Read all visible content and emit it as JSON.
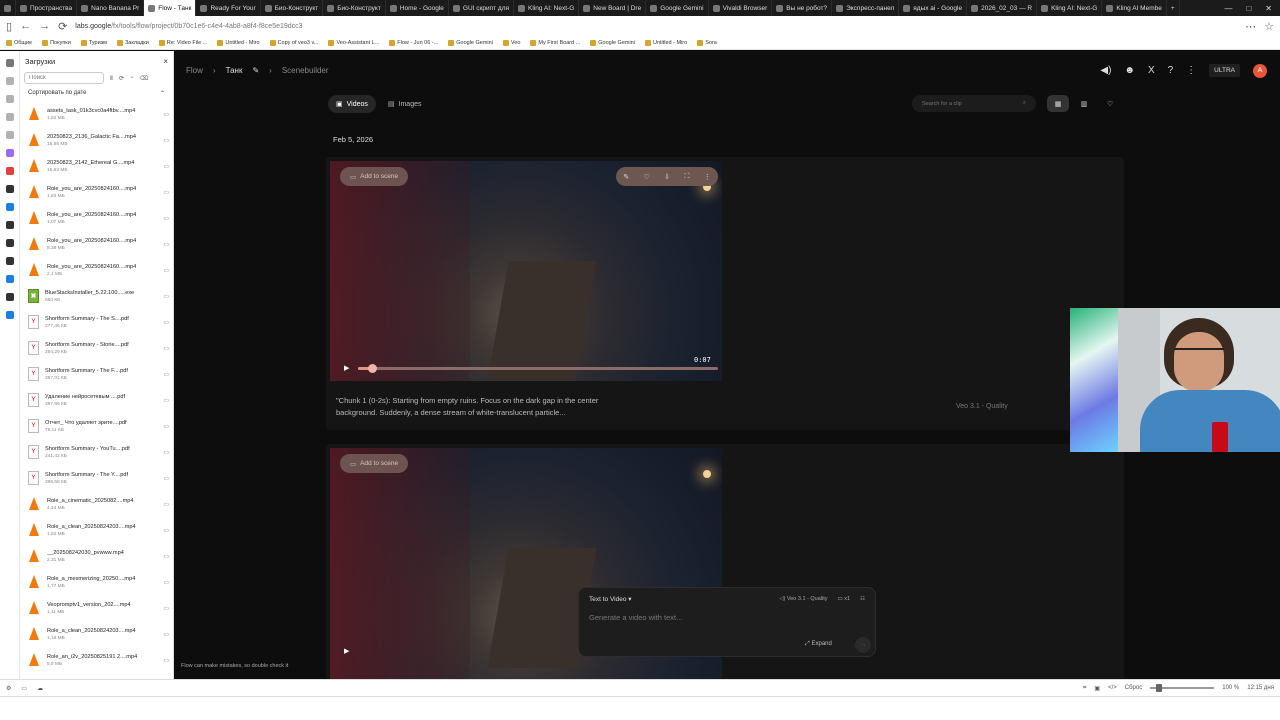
{
  "browser": {
    "tabs": [
      {
        "label": "Пространства",
        "active": false
      },
      {
        "label": "Nano Banana Pr",
        "active": false
      },
      {
        "label": "Flow - Танк",
        "active": true
      },
      {
        "label": "Ready For Your",
        "active": false
      },
      {
        "label": "Био-Конструкт",
        "active": false
      },
      {
        "label": "Био-Конструкт",
        "active": false
      },
      {
        "label": "Home - Google",
        "active": false
      },
      {
        "label": "GUI скрипт для",
        "active": false
      },
      {
        "label": "Kling AI: Next-G",
        "active": false
      },
      {
        "label": "New Board | Dre",
        "active": false
      },
      {
        "label": "Google Gemini",
        "active": false
      },
      {
        "label": "Vivaldi Browser",
        "active": false
      },
      {
        "label": "Вы не робот?",
        "active": false
      },
      {
        "label": "Экспресс-панел",
        "active": false
      },
      {
        "label": "ядых ai - Google",
        "active": false
      },
      {
        "label": "2026_02_03 — R",
        "active": false
      },
      {
        "label": "Kling AI: Next-G",
        "active": false
      },
      {
        "label": "Kling AI Membe",
        "active": false
      }
    ],
    "url_host": "labs.google",
    "url_path": "/fx/tools/flow/project/0b70c1e6-c4e4-4ab8-a8f4-f8ce5e19dcc3",
    "bookmarks": [
      "Общие",
      "Покупки",
      "Туризм",
      "Закладки",
      "Re: Video File ...",
      "Untitled - Miro",
      "Copy of veo3 v...",
      "Veo-Assistant L...",
      "Flow - Jun 06 -...",
      "Google Gemini",
      "Veo",
      "My First Board ...",
      "Google Gemini",
      "Untitled - Miro",
      "Sora"
    ],
    "window_controls": [
      "—",
      "□",
      "✕"
    ]
  },
  "downloads": {
    "title": "Загрузки",
    "search_placeholder": "Поиск",
    "sort_label": "Сортировать по дате",
    "items": [
      {
        "name": "assets_task_01k3cvc0a4ftbv....mp4",
        "size": "1,62 МБ",
        "icon": "vlc"
      },
      {
        "name": "20250823_2136_Galactic Fa....mp4",
        "size": "18,86 МБ",
        "icon": "vlc"
      },
      {
        "name": "20250823_2142_Ethereal G....mp4",
        "size": "15,63 МБ",
        "icon": "vlc"
      },
      {
        "name": "Role_you_are_20250824160....mp4",
        "size": "1,83 МБ",
        "icon": "vlc"
      },
      {
        "name": "Role_you_are_20250824160....mp4",
        "size": "1,07 МБ",
        "icon": "vlc"
      },
      {
        "name": "Role_you_are_20250824160....mp4",
        "size": "8,38 МБ",
        "icon": "vlc"
      },
      {
        "name": "Role_you_are_20250824160....mp4",
        "size": "2,1 МБ",
        "icon": "vlc"
      },
      {
        "name": "BlueStacksInstaller_5.22.100.....exe",
        "size": "850 КБ",
        "icon": "bluestacks"
      },
      {
        "name": "Shortform Summary - The S....pdf",
        "size": "277,46 КБ",
        "icon": "pdf"
      },
      {
        "name": "Shortform Summary - Storie....pdf",
        "size": "264,29 КБ",
        "icon": "pdf"
      },
      {
        "name": "Shortform Summary - The F....pdf",
        "size": "357,01 КБ",
        "icon": "pdf"
      },
      {
        "name": "Удаление нейросетевым ....pdf",
        "size": "387,69 КБ",
        "icon": "pdf"
      },
      {
        "name": "Отчет_ Что удаляет зрите....pdf",
        "size": "75,11 КБ",
        "icon": "pdf"
      },
      {
        "name": "Shortform Summary - YouTu....pdf",
        "size": "241,42 КБ",
        "icon": "pdf"
      },
      {
        "name": "Shortform Summary - The Y....pdf",
        "size": "395,58 КБ",
        "icon": "pdf"
      },
      {
        "name": "Role_a_cinematic_2025082....mp4",
        "size": "4,44 МБ",
        "icon": "vlc"
      },
      {
        "name": "Role_a_clean_20250824203....mp4",
        "size": "1,62 МБ",
        "icon": "vlc"
      },
      {
        "name": "__202508242030_pvwww.mp4",
        "size": "2,31 МБ",
        "icon": "vlc"
      },
      {
        "name": "Role_a_mesmerizing_20250....mp4",
        "size": "1,77 МБ",
        "icon": "vlc"
      },
      {
        "name": "Veopromptv1_version_202....mp4",
        "size": "1,11 МБ",
        "icon": "vlc"
      },
      {
        "name": "Role_a_clean_20250824203....mp4",
        "size": "1,16 МБ",
        "icon": "vlc"
      },
      {
        "name": "Role_an_i2v_20250825191 2....mp4",
        "size": "5,8 МБ",
        "icon": "vlc"
      }
    ]
  },
  "flow": {
    "breadcrumb": {
      "root": "Flow",
      "project": "Танк",
      "page": "Scenebuilder"
    },
    "ultra_badge": "ULTRA",
    "avatar_letter": "A",
    "tabs": [
      {
        "label": "Videos",
        "active": true
      },
      {
        "label": "Images",
        "active": false
      }
    ],
    "search_placeholder": "Search for a clip",
    "date_label": "Feb 5, 2026",
    "clips": [
      {
        "add_label": "Add to scene",
        "time": "0:07",
        "progress": 0.04,
        "prompt": "\"Chunk 1 (0-2s): Starting from empty ruins. Focus on the dark gap in the center background. Suddenly, a dense stream of white-translucent particle...",
        "model": "Veo 3.1 - Quality"
      },
      {
        "add_label": "Add to scene"
      }
    ],
    "composer": {
      "mode": "Text to Video",
      "model": "Veo 3.1 - Quality",
      "count": "x1",
      "placeholder": "Generate a video with text...",
      "expand": "Expand"
    },
    "disclaimer": "Flow can make mistakes, so double check it"
  },
  "statusbar": {
    "reset": "Сброс",
    "zoom": "100 %",
    "clock": "12:15 дня"
  },
  "colors": {
    "tab_bar": "#1b1b1b",
    "flow_background": "#0d0d0d",
    "accent_red": "#e8563a"
  }
}
